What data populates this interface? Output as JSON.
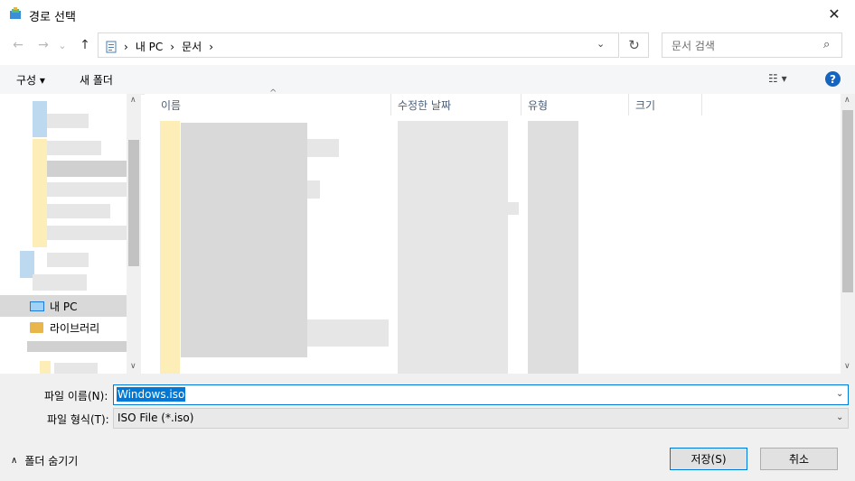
{
  "window": {
    "title": "경로 선택",
    "close_glyph": "✕"
  },
  "nav": {
    "back_glyph": "←",
    "forward_glyph": "→",
    "recent_glyph": "⌄",
    "up_glyph": "↑",
    "breadcrumbs": [
      "내 PC",
      "문서"
    ],
    "crumb_sep": "›",
    "dropdown_glyph": "⌄",
    "refresh_glyph": "↻",
    "search_placeholder": "문서 검색",
    "search_glyph": "⌕"
  },
  "toolbar": {
    "organize_label": "구성 ▾",
    "new_folder_label": "새 폴더",
    "view_glyph": "☷ ▾",
    "help_glyph": "?"
  },
  "navpane": {
    "items": [
      {
        "label": "내 PC",
        "icon": "computer-icon",
        "selected": true
      },
      {
        "label": "라이브러리",
        "icon": "library-icon",
        "selected": false
      }
    ]
  },
  "columns": [
    {
      "label": "이름"
    },
    {
      "label": "수정한 날짜"
    },
    {
      "label": "유형"
    },
    {
      "label": "크기"
    }
  ],
  "sort_glyph": "^",
  "scroll": {
    "up_glyph": "∧",
    "down_glyph": "∨"
  },
  "form": {
    "filename_label": "파일 이름(N):",
    "filename_value": "Windows.iso",
    "filetype_label": "파일 형식(T):",
    "filetype_value": "ISO File (*.iso)",
    "drop_glyph": "⌄"
  },
  "footer": {
    "hide_folders_label": "폴더 숨기기",
    "hide_glyph": "∧",
    "save_label": "저장(S)",
    "cancel_label": "취소"
  },
  "colors": {
    "accent": "#0078d7",
    "help": "#1565c0"
  }
}
